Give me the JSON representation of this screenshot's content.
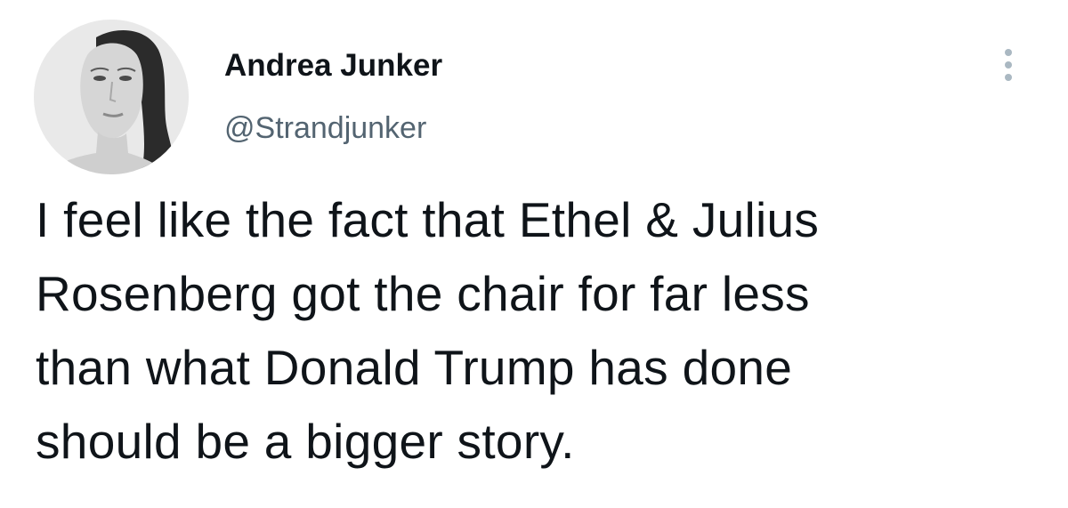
{
  "author": {
    "display_name": "Andrea Junker",
    "handle": "@Strandjunker",
    "avatar_icon": "profile-photo-avatar"
  },
  "tweet": {
    "lines": [
      "I feel like the fact that Ethel & Julius",
      "Rosenberg got the chair for far less",
      "than what Donald Trump has done",
      "should be a bigger story."
    ]
  },
  "more_button": {
    "icon": "more-options-icon"
  },
  "colors": {
    "text_primary": "#0f1419",
    "text_secondary": "#536471",
    "more_dots": "#aab8c2",
    "background": "#ffffff"
  }
}
